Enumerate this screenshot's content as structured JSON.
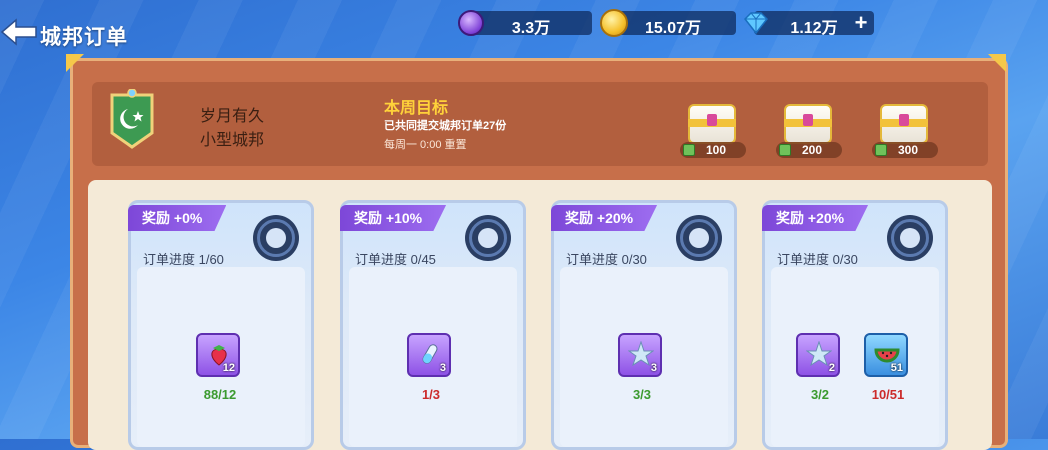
{
  "header": {
    "title": "城邦订单"
  },
  "resources": [
    {
      "icon": "purple-medal-icon",
      "value": "3.3万"
    },
    {
      "icon": "gold-coin-icon",
      "value": "15.07万"
    },
    {
      "icon": "diamond-icon",
      "value": "1.12万"
    }
  ],
  "city": {
    "name": "岁月有久",
    "type": "小型城邦"
  },
  "weekly_goal": {
    "title": "本周目标",
    "description": "已共同提交城邦订单27份",
    "reset": "每周一 0:00 重置",
    "chests": [
      {
        "icon": "chest-icon",
        "count": "100"
      },
      {
        "icon": "chest-icon",
        "count": "200"
      },
      {
        "icon": "chest-icon",
        "count": "300"
      }
    ]
  },
  "orders": [
    {
      "reward": "奖励 +0%",
      "progress": "订单进度 1/60",
      "items": [
        {
          "icon": "strawberry-icon",
          "count": "12",
          "submitted": "88/12",
          "complete": true
        }
      ]
    },
    {
      "reward": "奖励 +10%",
      "progress": "订单进度 0/45",
      "items": [
        {
          "icon": "potion-vial-icon",
          "count": "3",
          "submitted": "1/3",
          "complete": false
        }
      ]
    },
    {
      "reward": "奖励 +20%",
      "progress": "订单进度 0/30",
      "items": [
        {
          "icon": "starfish-icon",
          "count": "3",
          "submitted": "3/3",
          "complete": true
        }
      ]
    },
    {
      "reward": "奖励 +20%",
      "progress": "订单进度 0/30",
      "items": [
        {
          "icon": "starfish-icon",
          "count": "2",
          "submitted": "3/2",
          "complete": true
        },
        {
          "icon": "watermelon-icon",
          "count": "51",
          "submitted": "10/51",
          "complete": false
        }
      ]
    }
  ],
  "colors": {
    "accent_purple": "#8e52e6",
    "gold": "#ffd23a",
    "panel": "#c76f4a",
    "complete_green": "#3b9a2f"
  }
}
